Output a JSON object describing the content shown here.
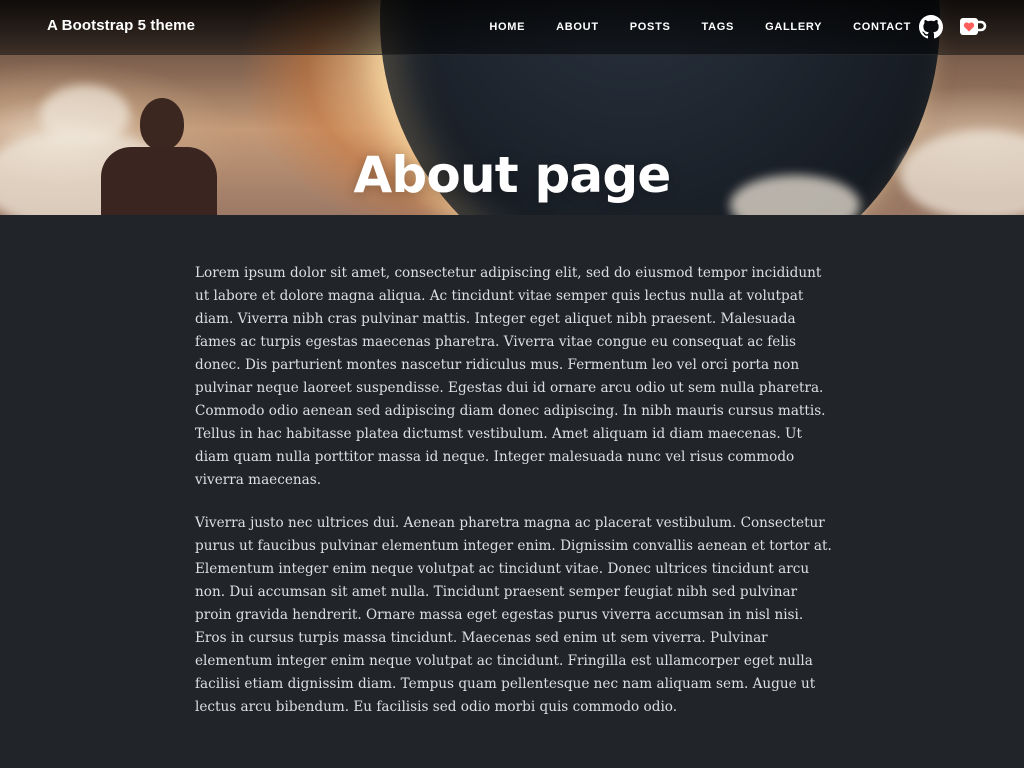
{
  "navbar": {
    "brand": "A Bootstrap 5 theme",
    "items": [
      {
        "label": "HOME"
      },
      {
        "label": "ABOUT"
      },
      {
        "label": "POSTS"
      },
      {
        "label": "TAGS"
      },
      {
        "label": "GALLERY"
      },
      {
        "label": "CONTACT"
      }
    ],
    "icons": [
      "github-icon",
      "kofi-cup-icon"
    ]
  },
  "hero": {
    "title": "About page"
  },
  "content": {
    "paragraphs": [
      "Lorem ipsum dolor sit amet, consectetur adipiscing elit, sed do eiusmod tempor incididunt ut labore et dolore magna aliqua. Ac tincidunt vitae semper quis lectus nulla at volutpat diam. Viverra nibh cras pulvinar mattis. Integer eget aliquet nibh praesent. Malesuada fames ac turpis egestas maecenas pharetra. Viverra vitae congue eu consequat ac felis donec. Dis parturient montes nascetur ridiculus mus. Fermentum leo vel orci porta non pulvinar neque laoreet suspendisse. Egestas dui id ornare arcu odio ut sem nulla pharetra. Commodo odio aenean sed adipiscing diam donec adipiscing. In nibh mauris cursus mattis. Tellus in hac habitasse platea dictumst vestibulum. Amet aliquam id diam maecenas. Ut diam quam nulla porttitor massa id neque. Integer malesuada nunc vel risus commodo viverra maecenas.",
      "Viverra justo nec ultrices dui. Aenean pharetra magna ac placerat vestibulum. Consectetur purus ut faucibus pulvinar elementum integer enim. Dignissim convallis aenean et tortor at. Elementum integer enim neque volutpat ac tincidunt vitae. Donec ultrices tincidunt arcu non. Dui accumsan sit amet nulla. Tincidunt praesent semper feugiat nibh sed pulvinar proin gravida hendrerit. Ornare massa eget egestas purus viverra accumsan in nisl nisi. Eros in cursus turpis massa tincidunt. Maecenas sed enim ut sem viverra. Pulvinar elementum integer enim neque volutpat ac tincidunt. Fringilla est ullamcorper eget nulla facilisi etiam dignissim diam. Tempus quam pellentesque nec nam aliquam sem. Augue ut lectus arcu bibendum. Eu facilisis sed odio morbi quis commodo odio."
    ]
  },
  "colors": {
    "page_background": "#212529",
    "text": "#dcdfe3",
    "nav_text": "#ffffff",
    "kofi_heart": "#ff5e5b"
  }
}
